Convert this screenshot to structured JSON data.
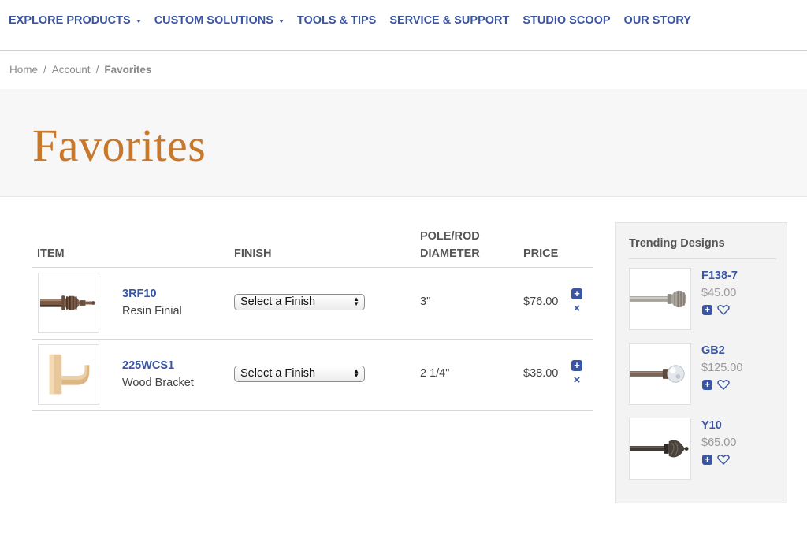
{
  "nav": {
    "items": [
      {
        "label": "EXPLORE PRODUCTS",
        "has_dropdown": true
      },
      {
        "label": "CUSTOM SOLUTIONS",
        "has_dropdown": true
      },
      {
        "label": "TOOLS & TIPS",
        "has_dropdown": false
      },
      {
        "label": "SERVICE & SUPPORT",
        "has_dropdown": false
      },
      {
        "label": "STUDIO SCOOP",
        "has_dropdown": false
      },
      {
        "label": "OUR STORY",
        "has_dropdown": false
      }
    ]
  },
  "breadcrumb": {
    "items": [
      "Home",
      "Account",
      "Favorites"
    ],
    "separator": "/"
  },
  "page": {
    "title": "Favorites"
  },
  "table": {
    "headers": {
      "item": "ITEM",
      "finish": "FINISH",
      "diameter": "POLE/ROD DIAMETER",
      "price": "PRICE"
    },
    "rows": [
      {
        "sku": "3RF10",
        "name": "Resin Finial",
        "finish": "Select a Finish",
        "diameter": "3\"",
        "price": "$76.00",
        "thumb": "finial-icon"
      },
      {
        "sku": "225WCS1",
        "name": "Wood Bracket",
        "finish": "Select a Finish",
        "diameter": "2 1/4\"",
        "price": "$38.00",
        "thumb": "bracket-icon"
      }
    ],
    "add_icon": "+",
    "remove_icon": "×"
  },
  "trending": {
    "title": "Trending Designs",
    "items": [
      {
        "sku": "F138-7",
        "price": "$45.00",
        "thumb": "rod-ball-finial-icon"
      },
      {
        "sku": "GB2",
        "price": "$125.00",
        "thumb": "rod-glass-ball-icon"
      },
      {
        "sku": "Y10",
        "price": "$65.00",
        "thumb": "rod-ornate-finial-icon"
      }
    ],
    "add_icon": "+"
  },
  "colors": {
    "brand_blue": "#3a55a1",
    "title_orange": "#c8782a",
    "hero_bg": "#f7f7f7"
  }
}
